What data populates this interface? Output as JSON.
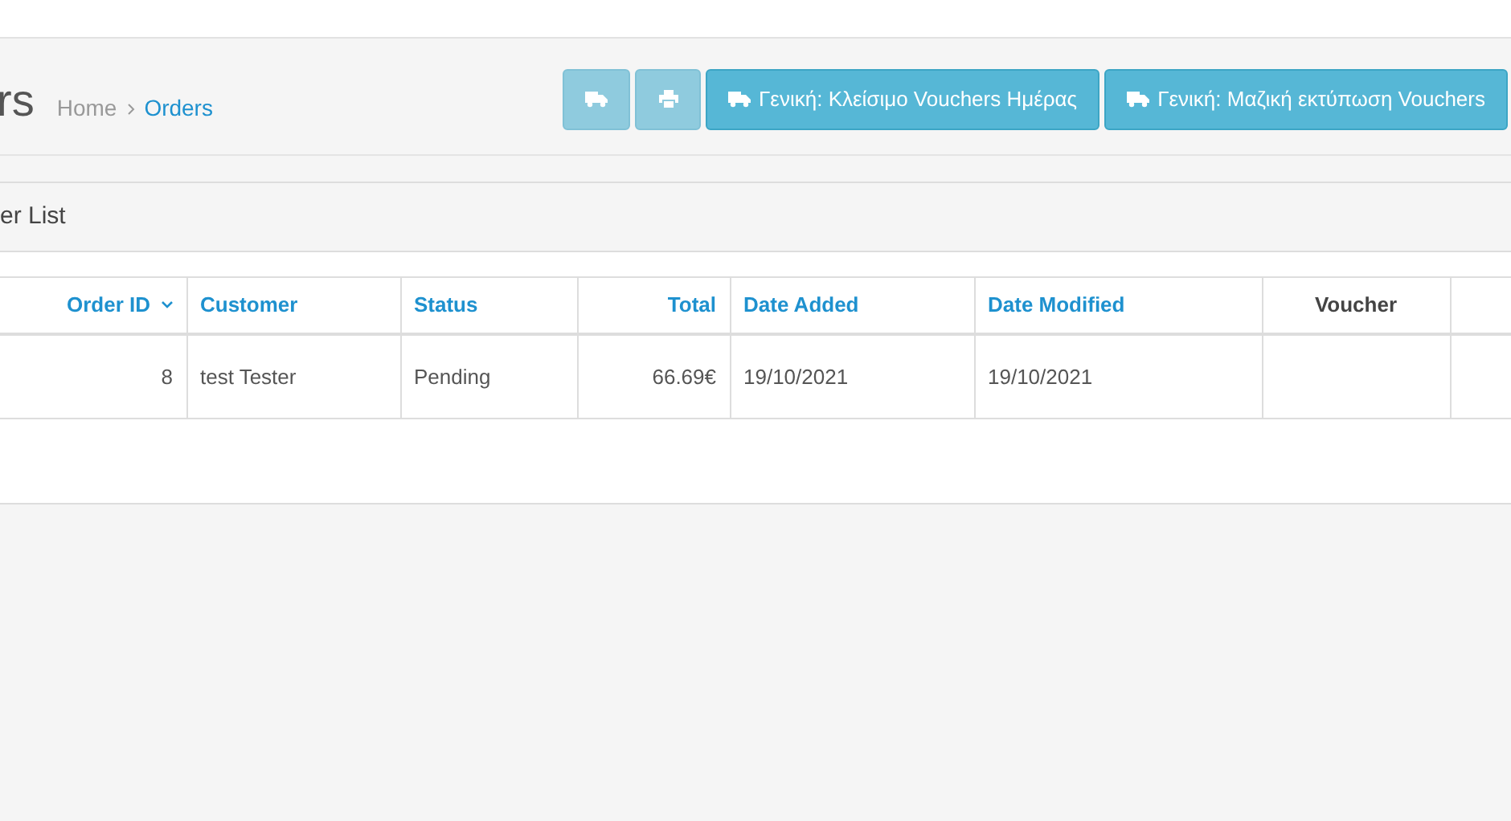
{
  "page_title": "rs",
  "breadcrumb": [
    {
      "label": "Home",
      "selected": false
    },
    {
      "label": "Orders",
      "selected": true
    }
  ],
  "header_buttons": [
    {
      "kind": "delivery",
      "disabled": true
    },
    {
      "kind": "print",
      "disabled": true
    },
    {
      "kind": "delivery",
      "label": "Γενική: Κλείσιμο Vouchers Ημέρας",
      "disabled": false
    },
    {
      "kind": "delivery",
      "label": "Γενική: Μαζική εκτύπωση Vouchers",
      "disabled": false
    }
  ],
  "panel": {
    "title": "er List"
  },
  "table": {
    "columns": [
      {
        "label": "Order ID",
        "sortable": true,
        "sorted": true
      },
      {
        "label": "Customer",
        "sortable": true,
        "sorted": false
      },
      {
        "label": "Status",
        "sortable": true,
        "sorted": false
      },
      {
        "label": "Total",
        "sortable": true,
        "sorted": false
      },
      {
        "label": "Date Added",
        "sortable": true,
        "sorted": false
      },
      {
        "label": "Date Modified",
        "sortable": true,
        "sorted": false
      },
      {
        "label": "Voucher",
        "sortable": false,
        "sorted": false
      }
    ],
    "rows": [
      [
        "8",
        "test Tester",
        "Pending",
        "66.69€",
        "19/10/2021",
        "19/10/2021",
        null
      ]
    ]
  }
}
